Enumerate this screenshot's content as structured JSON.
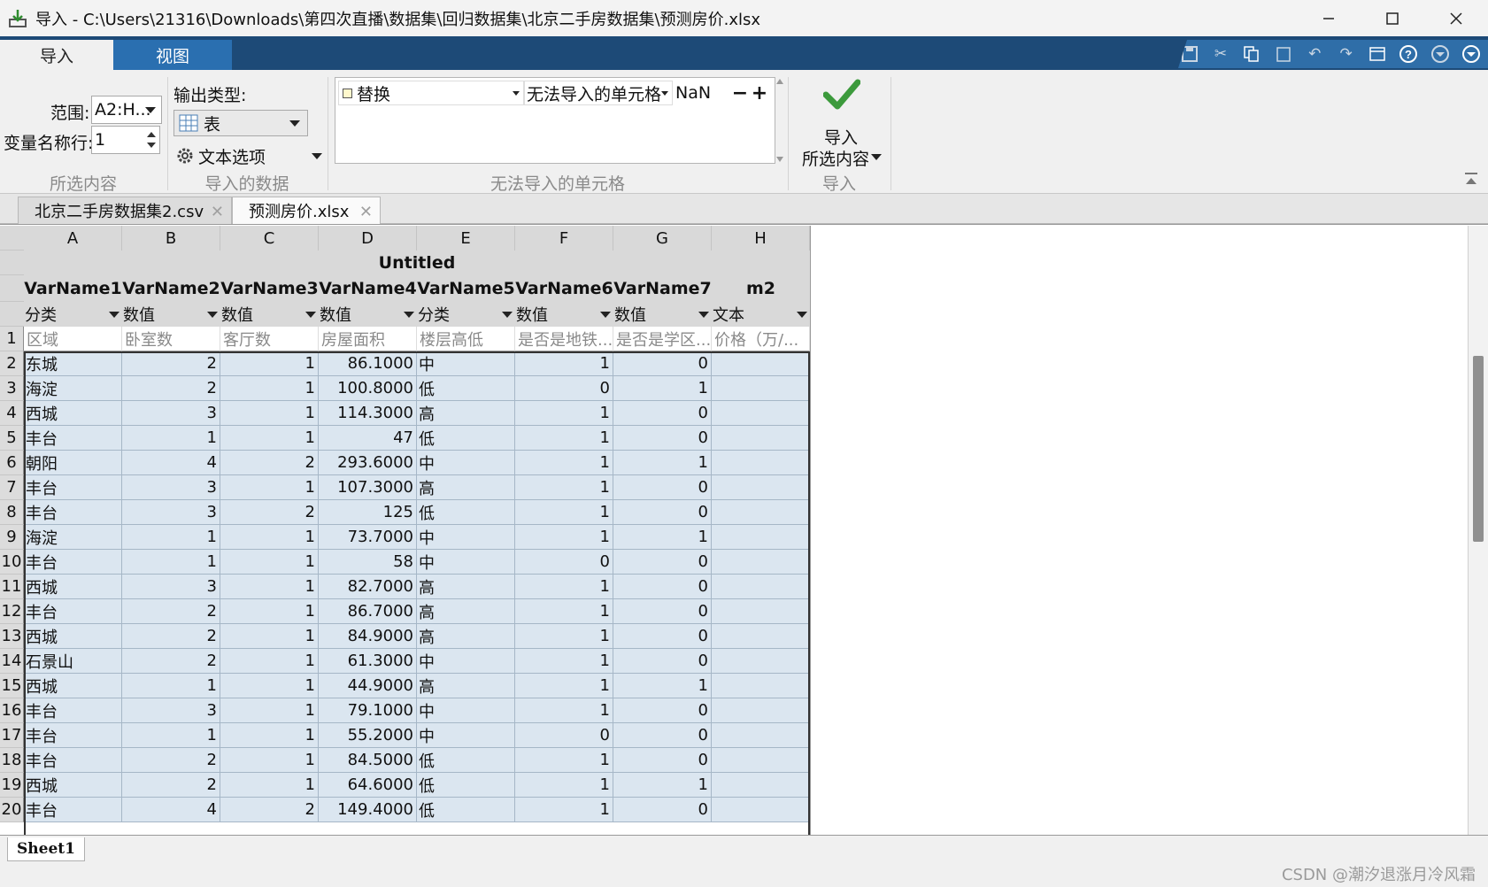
{
  "window": {
    "title": "导入 - C:\\Users\\21316\\Downloads\\第四次直播\\数据集\\回归数据集\\北京二手房数据集\\预测房价.xlsx"
  },
  "ribbon_tabs": [
    "导入",
    "视图"
  ],
  "selection": {
    "range_label": "范围:",
    "range_value": "A2:H...",
    "varname_row_label": "变量名称行:",
    "varname_row_value": "1",
    "group_label": "所选内容"
  },
  "import_data": {
    "output_type_label": "输出类型:",
    "output_type_value": "表",
    "text_options_label": "文本选项",
    "group_label": "导入的数据"
  },
  "unimportable": {
    "rule_action": "替换",
    "rule_target": "无法导入的单元格",
    "rule_value": "NaN",
    "minus": "−",
    "plus": "+",
    "group_label": "无法导入的单元格"
  },
  "import_action": {
    "label_line1": "导入",
    "label_line2": "所选内容",
    "group_label": "导入"
  },
  "doc_tabs": [
    "北京二手房数据集2.csv",
    "预测房价.xlsx"
  ],
  "sheet": {
    "table_name": "Untitled",
    "column_letters": [
      "A",
      "B",
      "C",
      "D",
      "E",
      "F",
      "G",
      "H"
    ],
    "var_names": [
      "VarName1",
      "VarName2",
      "VarName3",
      "VarName4",
      "VarName5",
      "VarName6",
      "VarName7",
      "m2"
    ],
    "var_types": [
      "分类",
      "数值",
      "数值",
      "数值",
      "分类",
      "数值",
      "数值",
      "文本"
    ],
    "header_row": [
      "区域",
      "卧室数",
      "客厅数",
      "房屋面积",
      "楼层高低",
      "是否是地铁...",
      "是否是学区...",
      "价格（万/..."
    ],
    "rows": [
      [
        "东城",
        "2",
        "1",
        "86.1000",
        "中",
        "1",
        "0",
        ""
      ],
      [
        "海淀",
        "2",
        "1",
        "100.8000",
        "低",
        "0",
        "1",
        ""
      ],
      [
        "西城",
        "3",
        "1",
        "114.3000",
        "高",
        "1",
        "0",
        ""
      ],
      [
        "丰台",
        "1",
        "1",
        "47",
        "低",
        "1",
        "0",
        ""
      ],
      [
        "朝阳",
        "4",
        "2",
        "293.6000",
        "中",
        "1",
        "1",
        ""
      ],
      [
        "丰台",
        "3",
        "1",
        "107.3000",
        "高",
        "1",
        "0",
        ""
      ],
      [
        "丰台",
        "3",
        "2",
        "125",
        "低",
        "1",
        "0",
        ""
      ],
      [
        "海淀",
        "1",
        "1",
        "73.7000",
        "中",
        "1",
        "1",
        ""
      ],
      [
        "丰台",
        "1",
        "1",
        "58",
        "中",
        "0",
        "0",
        ""
      ],
      [
        "西城",
        "3",
        "1",
        "82.7000",
        "高",
        "1",
        "0",
        ""
      ],
      [
        "丰台",
        "2",
        "1",
        "86.7000",
        "高",
        "1",
        "0",
        ""
      ],
      [
        "西城",
        "2",
        "1",
        "84.9000",
        "高",
        "1",
        "0",
        ""
      ],
      [
        "石景山",
        "2",
        "1",
        "61.3000",
        "中",
        "1",
        "0",
        ""
      ],
      [
        "西城",
        "1",
        "1",
        "44.9000",
        "高",
        "1",
        "1",
        ""
      ],
      [
        "丰台",
        "3",
        "1",
        "79.1000",
        "中",
        "1",
        "0",
        ""
      ],
      [
        "丰台",
        "1",
        "1",
        "55.2000",
        "中",
        "0",
        "0",
        ""
      ],
      [
        "丰台",
        "2",
        "1",
        "84.5000",
        "低",
        "1",
        "0",
        ""
      ],
      [
        "西城",
        "2",
        "1",
        "64.6000",
        "低",
        "1",
        "1",
        ""
      ],
      [
        "丰台",
        "4",
        "2",
        "149.4000",
        "低",
        "1",
        "0",
        ""
      ]
    ],
    "sheet_tab": "Sheet1"
  },
  "watermark": "CSDN @潮汐退涨月冷风霜",
  "colors": {
    "ribbon_dark": "#1d4a77",
    "tab_active_blue": "#2a6fb0",
    "cell_selected": "#dbe6f0",
    "check_green": "#3c9a3c"
  }
}
